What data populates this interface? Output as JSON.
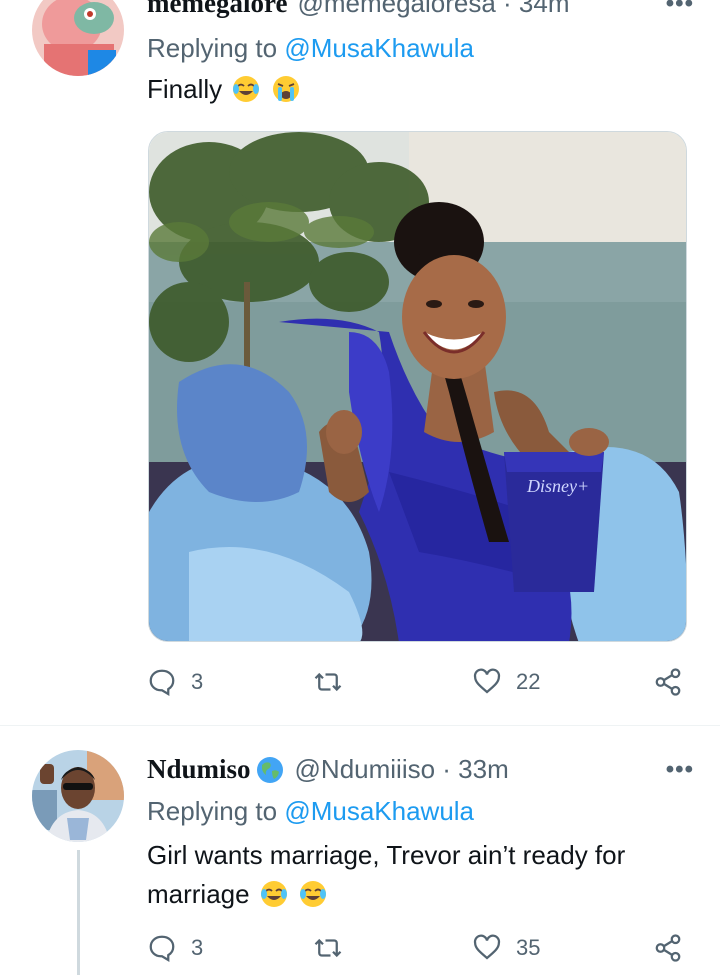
{
  "tweets": [
    {
      "display_name": "memegalore",
      "handle_time": "@memegaloresa · 34m",
      "replying_prefix": "Replying to",
      "replying_to": "@MusaKhawula",
      "text": "Finally",
      "emojis": [
        "joy-emoji",
        "crying-emoji"
      ],
      "stats": {
        "replies": "3",
        "retweets": "",
        "likes": "22"
      },
      "icons": {
        "reply": "reply-icon",
        "retweet": "retweet-icon",
        "like": "heart-icon",
        "share": "share-icon",
        "more": "more-icon"
      }
    },
    {
      "display_name": "Ndumiso",
      "handle_time": "@Ndumiiiso · 33m",
      "replying_prefix": "Replying to",
      "replying_to": "@MusaKhawula",
      "text": "Girl wants marriage, Trevor ain’t ready for marriage",
      "emojis": [
        "joy-emoji",
        "joy-emoji"
      ],
      "stats": {
        "replies": "3",
        "retweets": "",
        "likes": "35"
      },
      "icons": {
        "reply": "reply-icon",
        "retweet": "retweet-icon",
        "like": "heart-icon",
        "share": "share-icon",
        "more": "more-icon"
      }
    }
  ],
  "colors": {
    "link": "#1d9bf0",
    "secondary_text": "#536471",
    "dress_blue": "#2f2fb0"
  }
}
